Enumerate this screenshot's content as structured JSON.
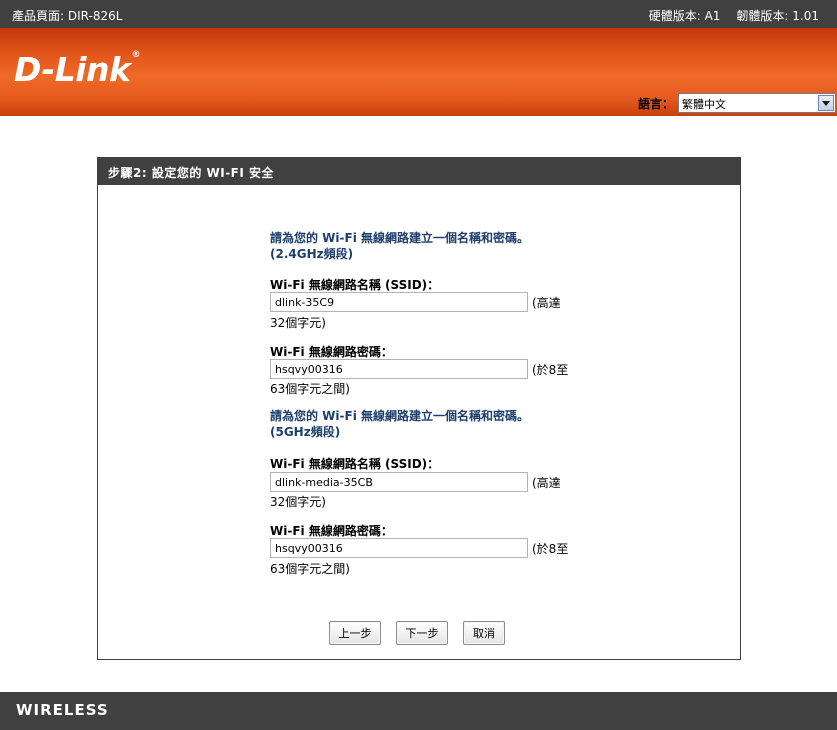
{
  "topbar": {
    "product": "產品頁面: DIR-826L",
    "hardware": "硬體版本: A1",
    "firmware": "韌體版本: 1.01"
  },
  "banner": {
    "logo_text": "D-Link",
    "logo_mark": "®",
    "language_label": "語言：",
    "language_value": "繁體中文"
  },
  "panel": {
    "header": "步驟2: 設定您的 WI-FI 安全",
    "band_24": {
      "title_line1": "請為您的 Wi-Fi 無線網路建立一個名稱和密碼。",
      "title_line2": "(2.4GHz頻段)",
      "ssid_label": "Wi-Fi 無線網路名稱 (SSID)：",
      "ssid_value": "dlink-35C9",
      "ssid_hint_after": "(高達",
      "ssid_hint_below": "32個字元)",
      "password_label": "Wi-Fi 無線網路密碼：",
      "password_value": "hsqvy00316",
      "password_hint_after": "(於8至",
      "password_hint_below": "63個字元之間)"
    },
    "band_5": {
      "title_line1": "請為您的 Wi-Fi 無線網路建立一個名稱和密碼。",
      "title_line2": "(5GHz頻段)",
      "ssid_label": "Wi-Fi 無線網路名稱 (SSID)：",
      "ssid_value": "dlink-media-35CB",
      "ssid_hint_after": "(高達",
      "ssid_hint_below": "32個字元)",
      "password_label": "Wi-Fi 無線網路密碼：",
      "password_value": "hsqvy00316",
      "password_hint_after": "(於8至",
      "password_hint_below": "63個字元之間)"
    },
    "buttons": {
      "prev": "上一步",
      "next": "下一步",
      "cancel": "取消"
    }
  },
  "footer": {
    "text": "WIRELESS"
  },
  "colors": {
    "dark_bar": "#404040",
    "banner_orange": "#e55a1e",
    "section_title_blue": "#1e3f6e"
  },
  "icons": {
    "language_dropdown": "chevron-down-icon"
  }
}
